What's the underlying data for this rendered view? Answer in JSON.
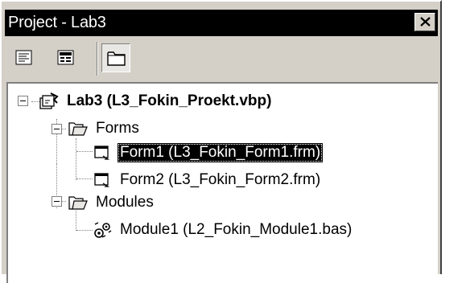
{
  "window": {
    "title": "Project - Lab3"
  },
  "toolbar": {
    "buttons": [
      {
        "name": "view-code",
        "icon": "view-code-icon"
      },
      {
        "name": "view-object",
        "icon": "view-object-icon"
      },
      {
        "name": "toggle-folders",
        "icon": "folder-icon",
        "pressed": true
      }
    ]
  },
  "tree": {
    "project": {
      "label": "Lab3 (L3_Fokin_Proekt.vbp)",
      "icon": "project-icon",
      "expanded": true
    },
    "forms_folder": {
      "label": "Forms",
      "icon": "folder-open-icon",
      "expanded": true
    },
    "form1": {
      "label": "Form1 (L3_Fokin_Form1.frm)",
      "icon": "form-icon",
      "selected": true
    },
    "form2": {
      "label": "Form2 (L3_Fokin_Form2.frm)",
      "icon": "form-icon"
    },
    "modules_folder": {
      "label": "Modules",
      "icon": "folder-open-icon",
      "expanded": true
    },
    "module1": {
      "label": "Module1 (L2_Fokin_Module1.bas)",
      "icon": "module-icon"
    }
  },
  "colors": {
    "titlebar": "#000000",
    "face": "#d4d0c8",
    "selection": "#000000"
  }
}
